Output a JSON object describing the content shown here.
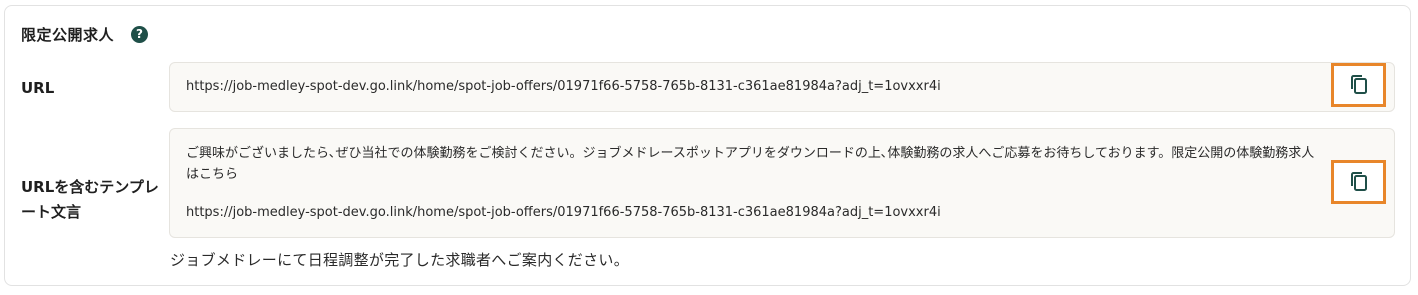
{
  "section": {
    "title": "限定公開求人",
    "help_icon": "question-circle-icon"
  },
  "url_row": {
    "label": "URL",
    "value": "https://job-medley-spot-dev.go.link/home/spot-job-offers/01971f66-5758-765b-8131-c361ae81984a?adj_t=1ovxxr4i",
    "copy_icon": "copy-icon"
  },
  "template_row": {
    "label": "URLを含むテンプレート文言",
    "body": "ご興味がございましたら､ぜひ当社での体験勤務をご検討ください。ジョブメドレースポットアプリをダウンロードの上､体験勤務の求人へご応募をお待ちしております。限定公開の体験勤務求人はこちら",
    "link": "https://job-medley-spot-dev.go.link/home/spot-job-offers/01971f66-5758-765b-8131-c361ae81984a?adj_t=1ovxxr4i",
    "copy_icon": "copy-icon"
  },
  "hint": "ジョブメドレーにて日程調整が完了した求職者へご案内ください。",
  "colors": {
    "highlight": "#e8862a",
    "help_icon_bg": "#1f4f48",
    "field_bg": "#faf9f6",
    "icon": "#1f4f48"
  }
}
